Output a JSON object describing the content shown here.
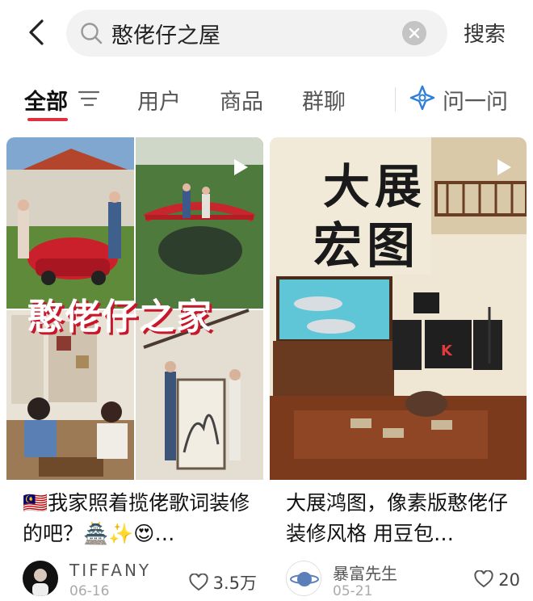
{
  "search": {
    "query": "憨佬仔之屋",
    "button_label": "搜索"
  },
  "tabs": [
    {
      "label": "全部",
      "active": true
    },
    {
      "label": "用户",
      "active": false
    },
    {
      "label": "商品",
      "active": false
    },
    {
      "label": "群聊",
      "active": false
    },
    {
      "label": "问一问",
      "active": false
    }
  ],
  "cards": [
    {
      "cover_caption": "憨佬仔之家",
      "title": "🇲🇾我家照着揽佬歌词装修的吧？🏯✨😍…",
      "author": "TIFFANY",
      "date": "06-16",
      "likes": "3.5万"
    },
    {
      "cover_text_1": "大展",
      "cover_text_2": "宏图",
      "title": "大展鸿图，像素版憨佬仔装修风格 用豆包…",
      "author": "暴富先生",
      "date": "05-21",
      "likes": "20"
    }
  ],
  "colors": {
    "accent": "#e0313f",
    "search_bg": "#f2f2f2",
    "ask_icon": "#2f7fd8"
  },
  "icons": [
    "back-arrow-icon",
    "search-icon",
    "clear-icon",
    "filter-icon",
    "ask-sparkle-icon",
    "play-icon",
    "heart-icon"
  ]
}
